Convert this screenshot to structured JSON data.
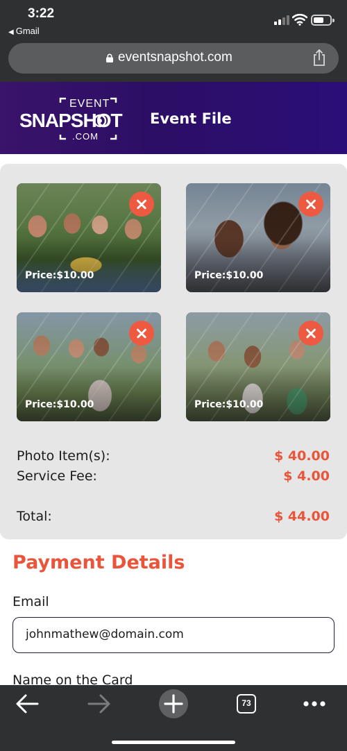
{
  "status_bar": {
    "time": "3:22",
    "back_app": "Gmail"
  },
  "browser": {
    "url": "eventsnapshot.com",
    "tab_count": "73"
  },
  "header": {
    "logo": {
      "line1": "EVENT",
      "line2": "SNAPSHOT",
      "line3": ".COM"
    },
    "title": "Event File"
  },
  "photos": [
    {
      "price": "Price:$10.00"
    },
    {
      "price": "Price:$10.00"
    },
    {
      "price": "Price:$10.00"
    },
    {
      "price": "Price:$10.00"
    }
  ],
  "summary": {
    "items_label": "Photo Item(s):",
    "items_value": "$ 40.00",
    "fee_label": "Service Fee:",
    "fee_value": "$ 4.00",
    "total_label": "Total:",
    "total_value": "$ 44.00"
  },
  "payment": {
    "title": "Payment Details",
    "email_label": "Email",
    "email_value": "johnmathew@domain.com",
    "name_label": "Name on the Card"
  },
  "colors": {
    "accent": "#e8553a",
    "header_bg": "#2c0e66",
    "card_bg": "#e6e6e6",
    "chrome": "#2f3032"
  }
}
